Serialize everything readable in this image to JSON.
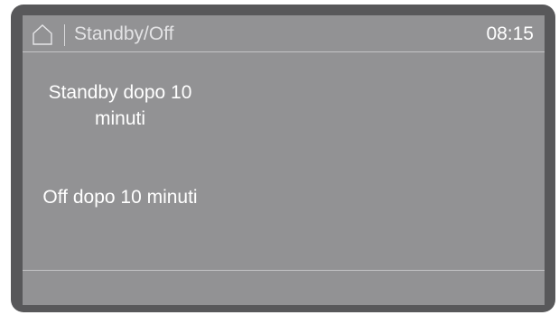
{
  "header": {
    "title": "Standby/Off",
    "time": "08:15",
    "home_icon": "home-icon"
  },
  "menu": {
    "options": [
      {
        "label": "Standby dopo 10 minuti"
      },
      {
        "label": "Off dopo 10 minuti"
      }
    ]
  },
  "colors": {
    "bezel": "#58585a",
    "screen": "#929294",
    "text": "#ffffff",
    "divider": "#c4c4c6"
  }
}
